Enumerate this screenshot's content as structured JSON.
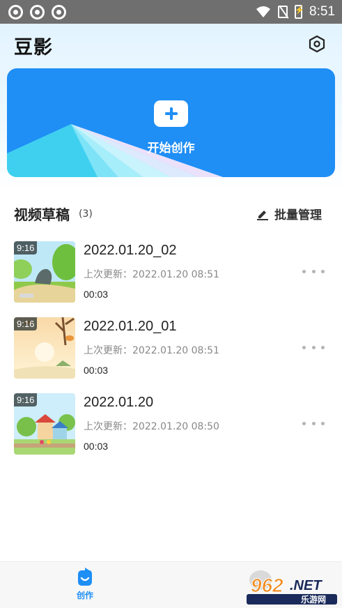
{
  "status_bar": {
    "time": "8:51",
    "icons": [
      "sync-icon",
      "sync-icon",
      "sync-icon",
      "wifi-icon",
      "no-sim-icon",
      "battery-charging-icon"
    ]
  },
  "header": {
    "title": "豆影",
    "settings_icon": "settings-hexagon-icon"
  },
  "create_card": {
    "label": "开始创作",
    "icon": "plus-icon",
    "accent": "#1f8ef5"
  },
  "drafts_section": {
    "title": "视频草稿",
    "count": "(3)",
    "batch_label": "批量管理",
    "batch_icon": "pencil-icon"
  },
  "drafts": [
    {
      "name": "2022.01.20_02",
      "updated": "上次更新：2022.01.20 08:51",
      "duration": "00:03",
      "ratio": "9:16"
    },
    {
      "name": "2022.01.20_01",
      "updated": "上次更新：2022.01.20 08:51",
      "duration": "00:03",
      "ratio": "9:16"
    },
    {
      "name": "2022.01.20",
      "updated": "上次更新：2022.01.20 08:50",
      "duration": "00:03",
      "ratio": "9:16"
    }
  ],
  "bottom_nav": {
    "items": [
      {
        "label": "创作",
        "icon": "create-icon",
        "active": true
      }
    ]
  },
  "watermark": {
    "text": "962.NET",
    "subtext": "乐游网"
  }
}
